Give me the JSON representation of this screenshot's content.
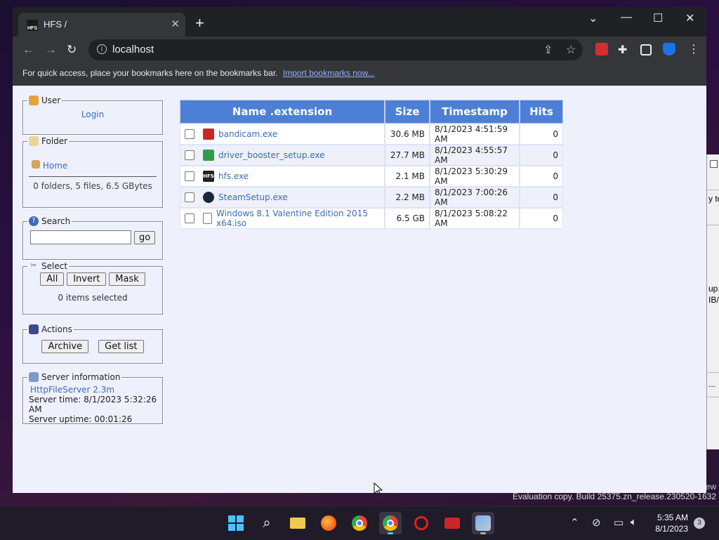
{
  "browser": {
    "tab_title": "HFS /",
    "favicon_text": "HFS",
    "new_tab": "+",
    "url": "localhost",
    "bookmarks_prompt": "For quick access, place your bookmarks here on the bookmarks bar.",
    "import_link": "Import bookmarks now..."
  },
  "panels": {
    "user": {
      "legend": "User",
      "login": "Login"
    },
    "folder": {
      "legend": "Folder",
      "home": "Home",
      "summary": "0 folders, 5 files, 6.5 GBytes"
    },
    "search": {
      "legend": "Search",
      "placeholder": "",
      "go": "go"
    },
    "select": {
      "legend": "Select",
      "all": "All",
      "invert": "Invert",
      "mask": "Mask",
      "status": "0 items selected"
    },
    "actions": {
      "legend": "Actions",
      "archive": "Archive",
      "get_list": "Get list"
    },
    "server": {
      "legend": "Server information",
      "version": "HttpFileServer 2.3m",
      "time": "Server time: 8/1/2023 5:32:26 AM",
      "uptime": "Server uptime: 00:01:26"
    }
  },
  "table": {
    "headers": [
      "Name .extension",
      "Size",
      "Timestamp",
      "Hits"
    ],
    "rows": [
      {
        "name": "bandicam.exe",
        "size": "30.6 MB",
        "timestamp": "8/1/2023 4:51:59 AM",
        "hits": "0",
        "icon": "bandicam-icon"
      },
      {
        "name": "driver_booster_setup.exe",
        "size": "27.7 MB",
        "timestamp": "8/1/2023 4:55:57 AM",
        "hits": "0",
        "icon": "driver-booster-icon"
      },
      {
        "name": "hfs.exe",
        "size": "2.1 MB",
        "timestamp": "8/1/2023 5:30:29 AM",
        "hits": "0",
        "icon": "hfs-icon"
      },
      {
        "name": "SteamSetup.exe",
        "size": "2.2 MB",
        "timestamp": "8/1/2023 7:00:26 AM",
        "hits": "0",
        "icon": "steam-icon"
      },
      {
        "name": "Windows 8.1 Valentine Edition 2015 x64.iso",
        "size": "6.5 GB",
        "timestamp": "8/1/2023 5:08:22 AM",
        "hits": "0",
        "icon": "file-icon"
      }
    ]
  },
  "desktop": {
    "eval_text": "Evaluation copy. Build 25375.zn_release.230520-1632",
    "ew": "ew",
    "bg_window_lines": [
      "y to",
      "up.",
      "IB/s",
      "..."
    ]
  },
  "taskbar": {
    "time": "5:35 AM",
    "date": "8/1/2023",
    "notification_count": "3"
  },
  "colors": {
    "header_blue": "#4d7fd6",
    "page_bg": "#eef0fc",
    "link": "#3a6cb8"
  }
}
